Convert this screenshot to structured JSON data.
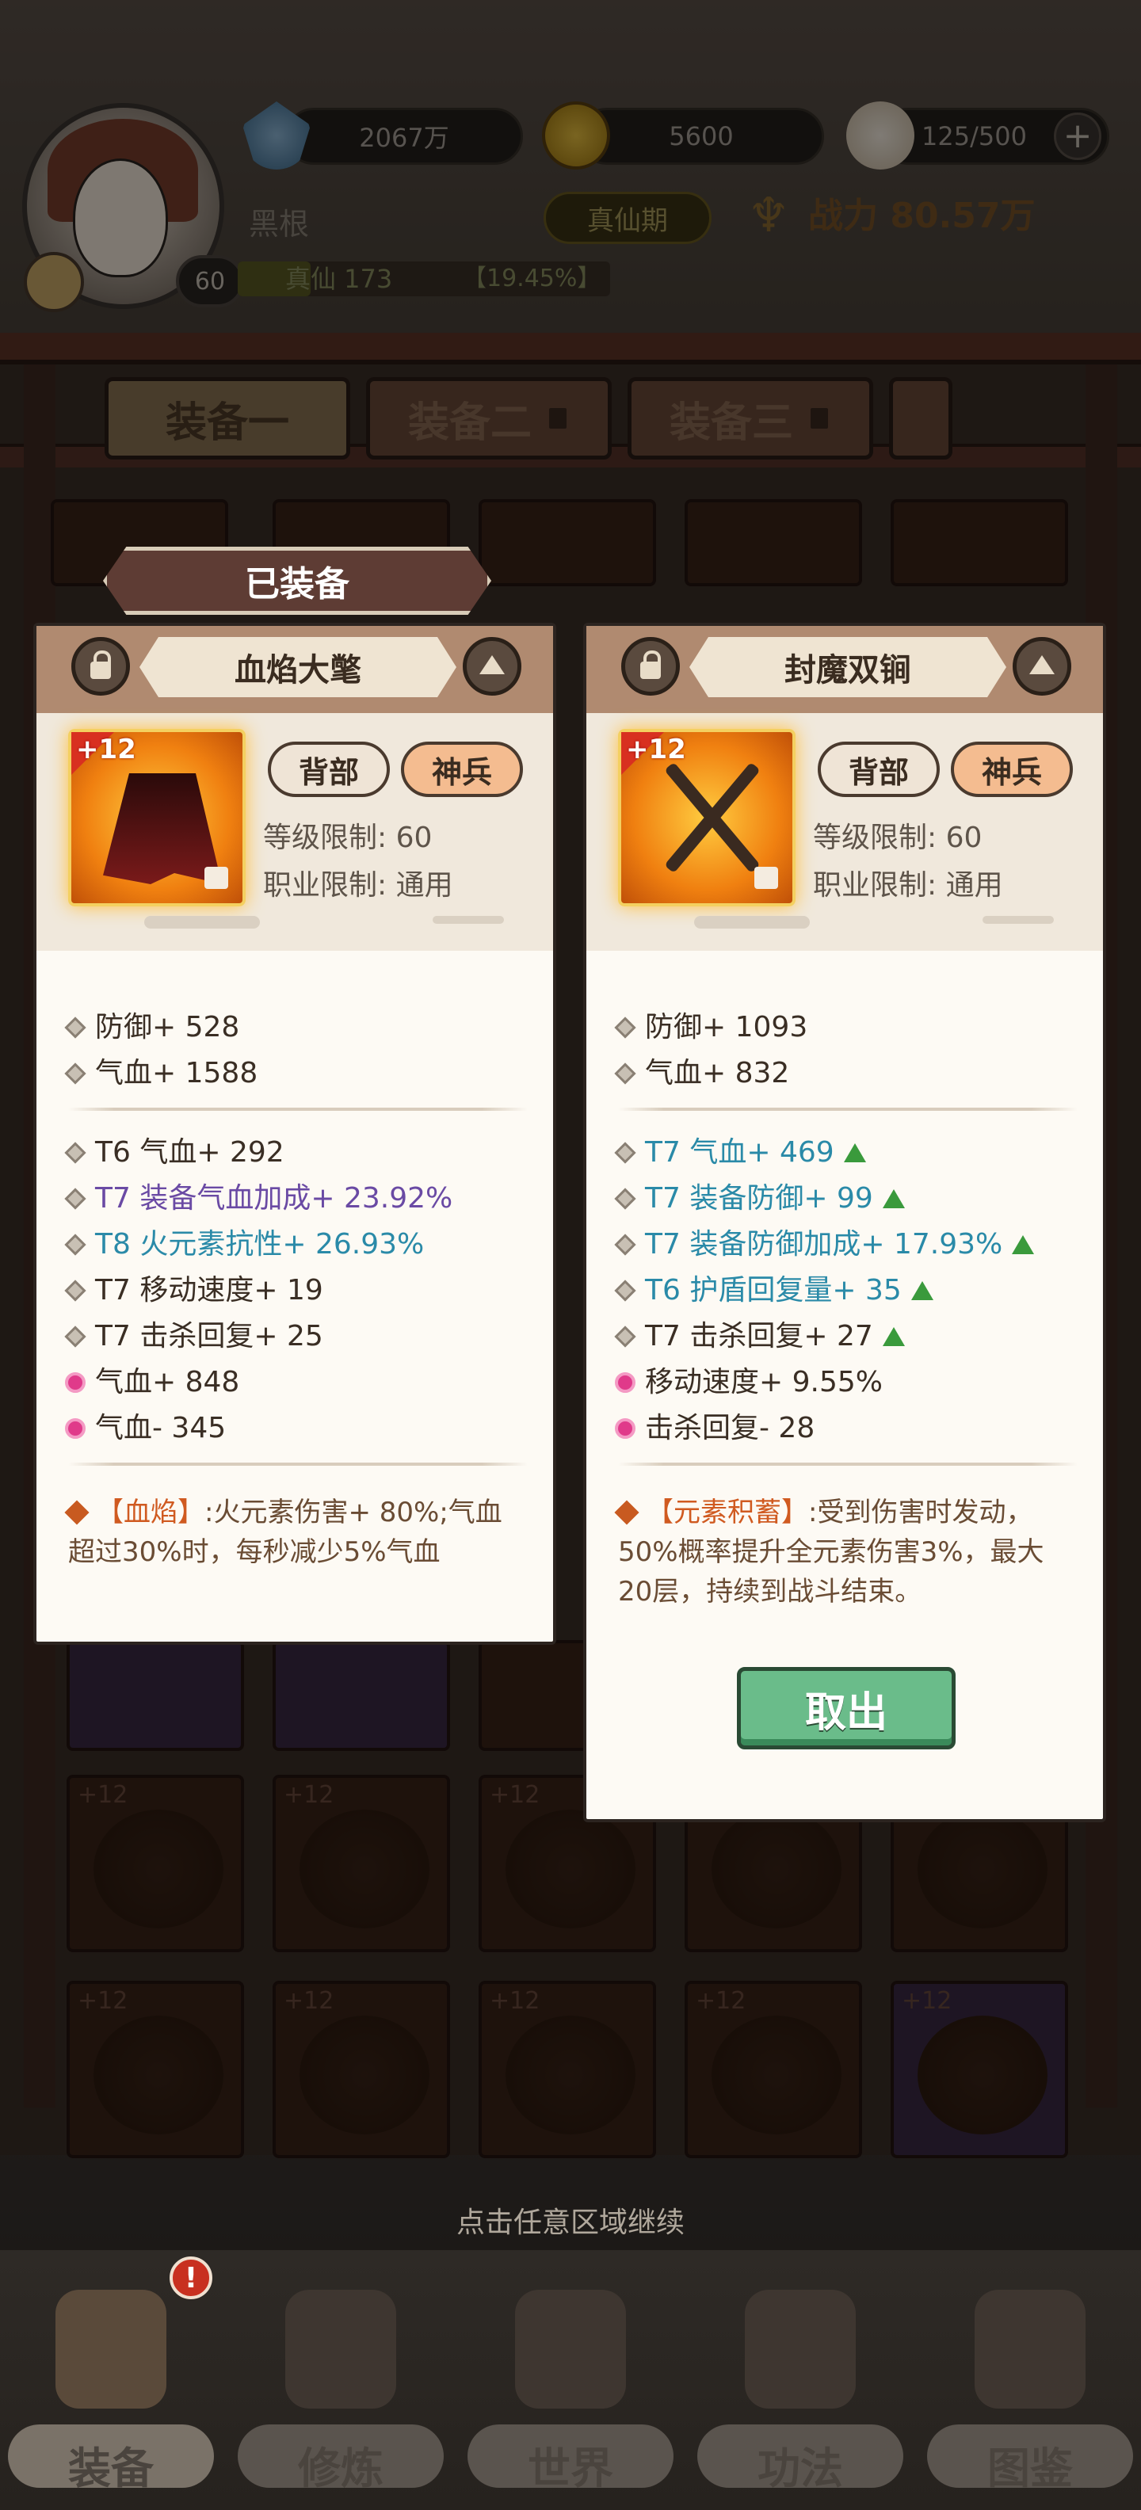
{
  "header": {
    "resources": [
      {
        "icon": "spirit-stone-icon",
        "value": "2067万"
      },
      {
        "icon": "gold-coin-icon",
        "value": "5600"
      },
      {
        "icon": "steamed-bun-icon",
        "value": "125/500"
      }
    ],
    "player_name": "黑根",
    "level": "60",
    "realm_badge": "真仙期",
    "power_label": "战力",
    "power_value": "80.57万",
    "cultivation_text": "真仙 173",
    "cultivation_pct": "【19.45%】"
  },
  "tabs": [
    {
      "label": "装备一",
      "locked": false
    },
    {
      "label": "装备二",
      "locked": true
    },
    {
      "label": "装备三",
      "locked": true
    }
  ],
  "equipped_label": "已装备",
  "left_panel": {
    "title": "血焰大氅",
    "enhance": "+12",
    "slot_tag": "背部",
    "grade_tag": "神兵",
    "level_req": "等级限制: 60",
    "class_req": "职业限制: 通用",
    "base_stats": [
      "防御+ 528",
      "气血+ 1588"
    ],
    "extra_stats": [
      {
        "text": "T6 气血+ 292"
      },
      {
        "text": "T7 装备气血加成+ 23.92%"
      },
      {
        "text": "T8 火元素抗性+ 26.93%"
      },
      {
        "text": "T7 移动速度+ 19"
      },
      {
        "text": "T7 击杀回复+ 25"
      },
      {
        "text": "气血+ 848"
      },
      {
        "text": "气血- 345"
      }
    ],
    "skill_name": "【血焰】",
    "skill_desc": ":火元素伤害+ 80%;气血超过30%时，每秒减少5%气血"
  },
  "right_panel": {
    "title": "封魔双锏",
    "enhance": "+12",
    "slot_tag": "背部",
    "grade_tag": "神兵",
    "level_req": "等级限制: 60",
    "class_req": "职业限制: 通用",
    "base_stats": [
      "防御+ 1093",
      "气血+ 832"
    ],
    "extra_stats": [
      {
        "text": "T7 气血+ 469"
      },
      {
        "text": "T7 装备防御+ 99"
      },
      {
        "text": "T7 装备防御加成+ 17.93%"
      },
      {
        "text": "T6 护盾回复量+ 35"
      },
      {
        "text": "T7 击杀回复+ 27"
      },
      {
        "text": "移动速度+ 9.55%"
      },
      {
        "text": "击杀回复- 28"
      }
    ],
    "skill_name": "【元素积蓄】",
    "skill_desc": ":受到伤害时发动，50%概率提升全元素伤害3%，最大20层，持续到战斗结束。",
    "action_button": "取出"
  },
  "grid_plus_label": "+12",
  "hint": "点击任意区域继续",
  "nav": [
    {
      "label": "装备",
      "badge": "!"
    },
    {
      "label": "修炼"
    },
    {
      "label": "世界"
    },
    {
      "label": "功法"
    },
    {
      "label": "图鉴"
    }
  ],
  "colors": {
    "purple_stat": "#6a4aa4",
    "blue_stat": "#2a8aa8",
    "up_arrow": "#3a9a3c",
    "skill_name": "#d05a20",
    "grade_pill": "#f4bc90",
    "takeout_button": "#6abc8a"
  }
}
